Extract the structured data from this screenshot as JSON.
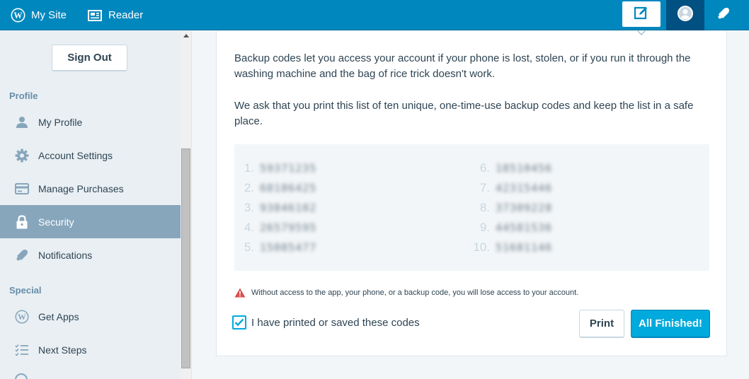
{
  "masterbar": {
    "my_site": "My Site",
    "reader": "Reader",
    "icons": {
      "my_site": "wordpress-logo-icon",
      "reader": "reader-icon",
      "write": "write-post-icon",
      "me": "avatar-icon",
      "notifications": "notifications-bell-icon"
    }
  },
  "sidebar": {
    "sign_out": "Sign Out",
    "profile_heading": "Profile",
    "special_heading": "Special",
    "items": [
      {
        "label": "My Profile",
        "icon": "user-icon"
      },
      {
        "label": "Account Settings",
        "icon": "gear-icon"
      },
      {
        "label": "Manage Purchases",
        "icon": "credit-card-icon"
      },
      {
        "label": "Security",
        "icon": "lock-icon",
        "selected": true
      },
      {
        "label": "Notifications",
        "icon": "bell-icon"
      },
      {
        "label": "Get Apps",
        "icon": "wordpress-icon"
      },
      {
        "label": "Next Steps",
        "icon": "checklist-icon"
      }
    ]
  },
  "main": {
    "intro": "Backup codes let you access your account if your phone is lost, stolen, or if you run it through the washing machine and the bag of rice trick doesn't work.",
    "request": "We ask that you print this list of ten unique, one-time-use backup codes and keep the list in a safe place.",
    "codes": [
      {
        "n": "1.",
        "v": "59371235"
      },
      {
        "n": "2.",
        "v": "68186425"
      },
      {
        "n": "3.",
        "v": "93846102"
      },
      {
        "n": "4.",
        "v": "26579595"
      },
      {
        "n": "5.",
        "v": "15085477"
      },
      {
        "n": "6.",
        "v": "18510456"
      },
      {
        "n": "7.",
        "v": "42315446"
      },
      {
        "n": "8.",
        "v": "37309228"
      },
      {
        "n": "9.",
        "v": "44581536"
      },
      {
        "n": "10.",
        "v": "51681146"
      }
    ],
    "warning": "Without access to the app, your phone, or a backup code, you will lose access to your account.",
    "checkbox_label": "I have printed or saved these codes",
    "checkbox_checked": true,
    "print_button": "Print",
    "finish_button": "All Finished!"
  },
  "colors": {
    "masterbar": "#0087be",
    "accent": "#00aadc",
    "selected": "#87a6bc",
    "warning": "#d94f4f"
  }
}
